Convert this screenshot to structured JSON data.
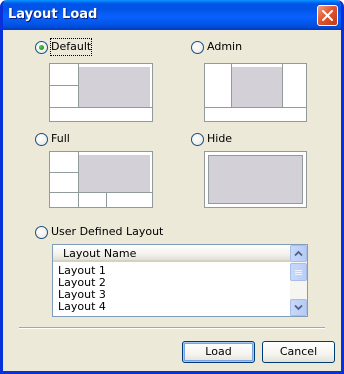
{
  "window": {
    "title": "Layout Load"
  },
  "options": {
    "default": {
      "label": "Default",
      "checked": true
    },
    "admin": {
      "label": "Admin",
      "checked": false
    },
    "full": {
      "label": "Full",
      "checked": false
    },
    "hide": {
      "label": "Hide",
      "checked": false
    },
    "user_defined": {
      "label": "User Defined Layout",
      "checked": false
    }
  },
  "layout_list": {
    "header": "Layout Name",
    "items": [
      "Layout 1",
      "Layout 2",
      "Layout 3",
      "Layout 4"
    ]
  },
  "buttons": {
    "load": "Load",
    "cancel": "Cancel"
  },
  "colors": {
    "titlebar": "#0055ea",
    "dialog_bg": "#ece9d8",
    "preview_pane": "#d4d0d8",
    "close_button": "#e2552e"
  }
}
